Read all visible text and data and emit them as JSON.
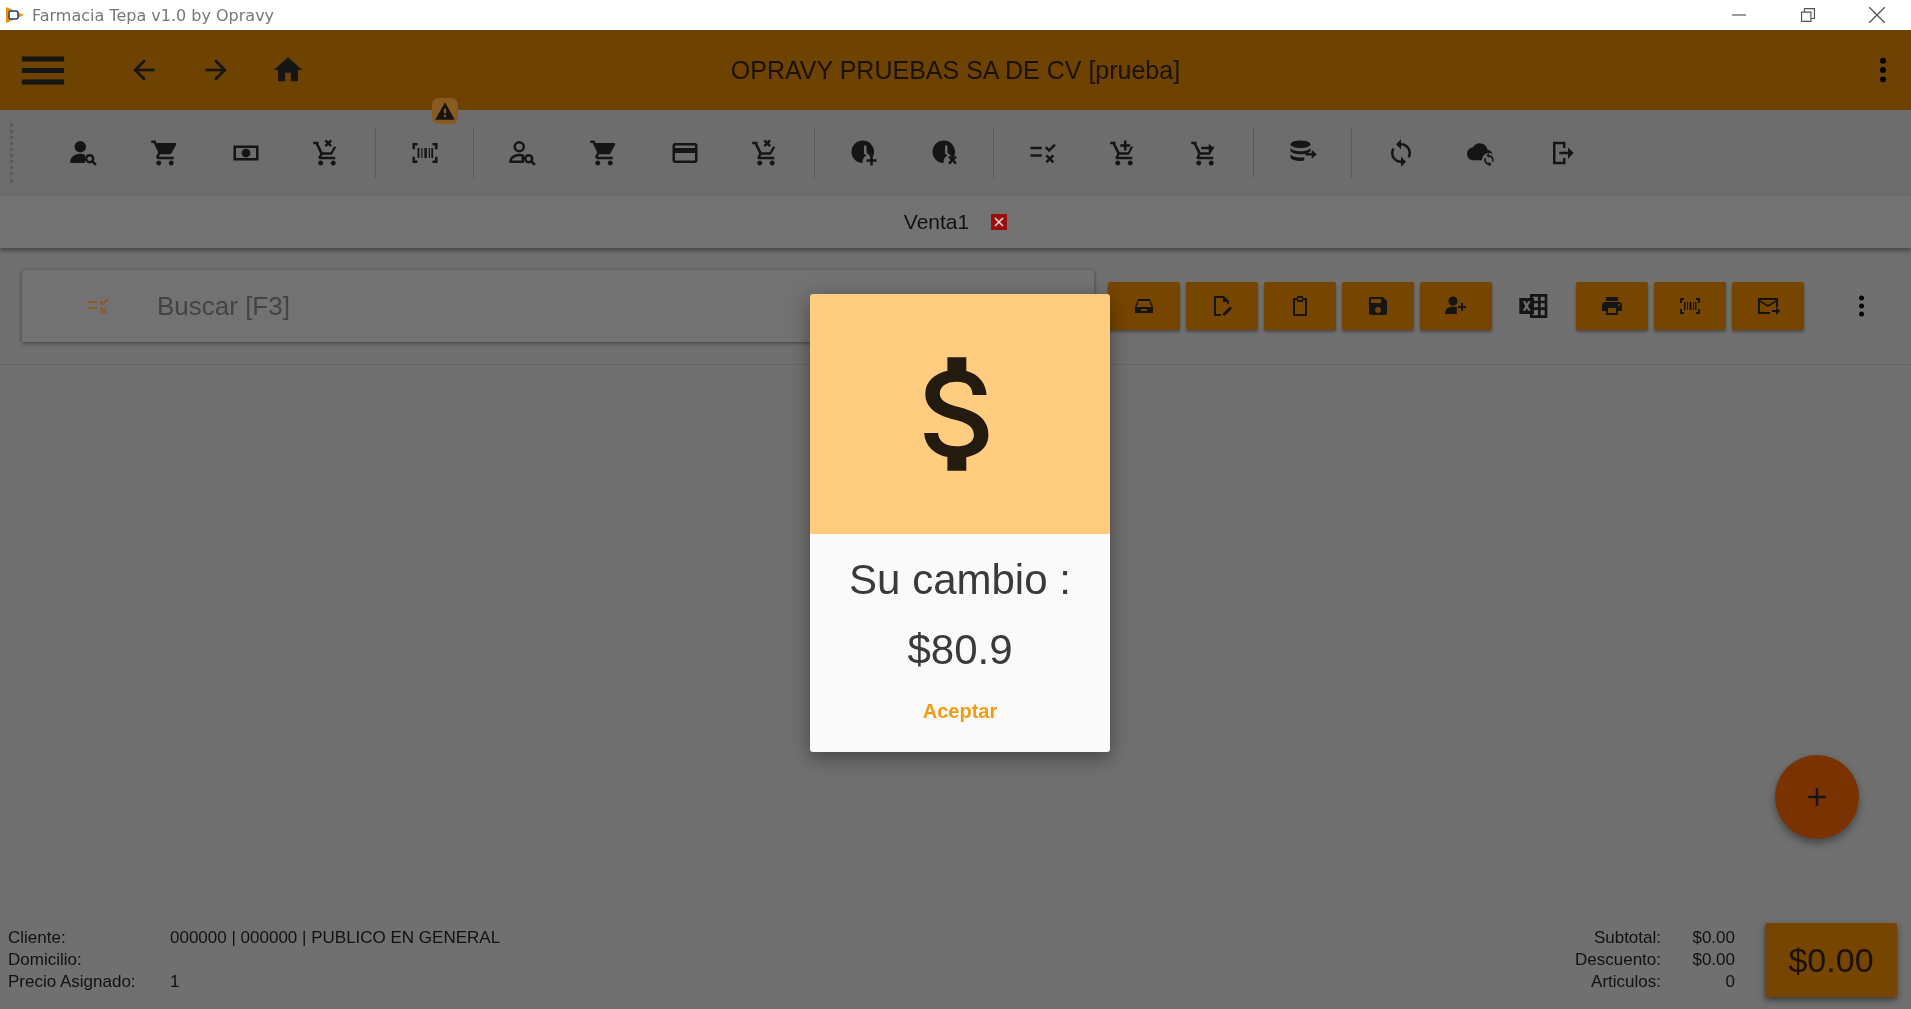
{
  "window": {
    "title": "Farmacia Tepa v1.0 by Opravy"
  },
  "app_bar": {
    "title": "OPRAVY PRUEBAS SA DE CV [prueba]"
  },
  "tabs": [
    {
      "label": "Venta1",
      "selected": true
    }
  ],
  "search": {
    "placeholder": "Buscar [F3]"
  },
  "dialog": {
    "heading": "Su cambio :",
    "amount": "$80.9",
    "button": "Aceptar"
  },
  "customer_info": [
    {
      "label": "Cliente:",
      "value": "000000 | 000000 | PUBLICO EN GENERAL"
    },
    {
      "label": "Domicilio:"
    },
    {
      "label": "Precio Asignado:",
      "value": "1"
    }
  ],
  "totals": [
    {
      "label": "Subtotal:",
      "value": "$0.00"
    },
    {
      "label": "Descuento:",
      "value": "$0.00"
    },
    {
      "label": "Articulos:",
      "value": "0"
    }
  ],
  "total_button": "$0.00"
}
